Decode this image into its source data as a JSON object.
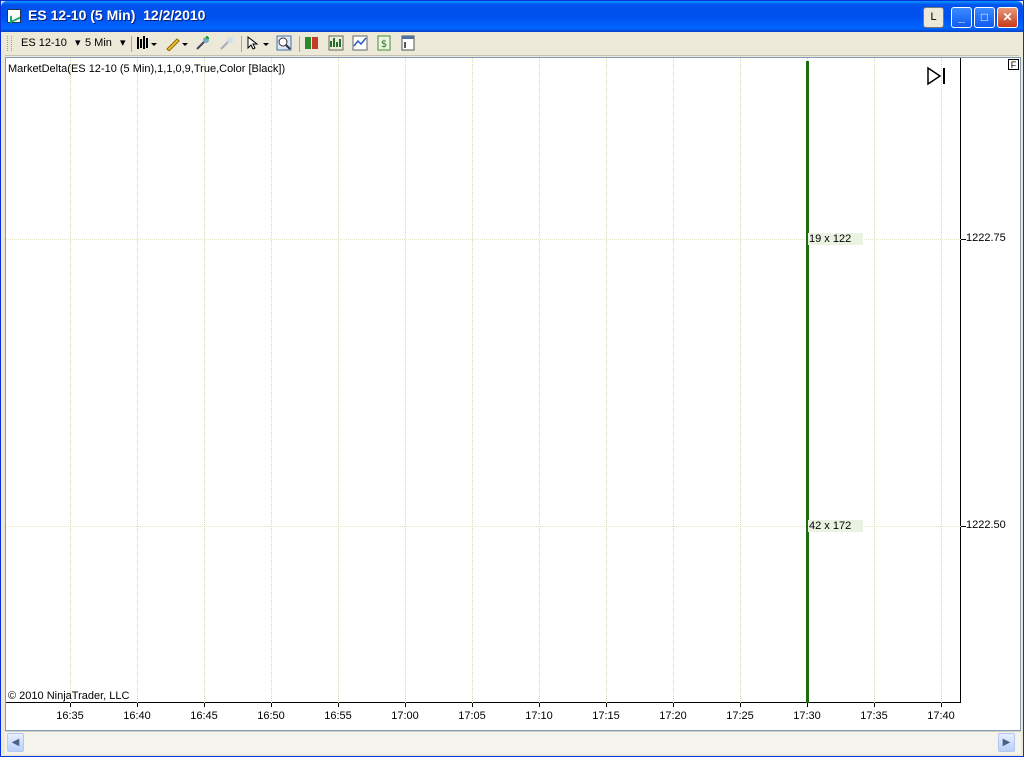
{
  "window": {
    "title": "ES 12-10 (5 Min)  12/2/2010",
    "buttons": {
      "layout": "L",
      "minimize": "_",
      "maximize": "□",
      "close": "✕"
    }
  },
  "toolbar": {
    "instrument": "ES 12-10",
    "interval": "5 Min",
    "dropdown_glyph": "▾"
  },
  "chart": {
    "indicator_label": "MarketDelta(ES 12-10 (5 Min),1,1,0,9,True,Color [Black])",
    "copyright": "© 2010 NinjaTrader, LLC",
    "f_marker": "F",
    "colors": {
      "bar": "#1f6b10",
      "cell_bg": "#eaf2e1",
      "grid": "#d6d6b0"
    }
  },
  "chart_data": {
    "type": "table",
    "x_ticks": [
      "16:35",
      "16:40",
      "16:45",
      "16:50",
      "16:55",
      "17:00",
      "17:05",
      "17:10",
      "17:15",
      "17:20",
      "17:25",
      "17:30",
      "17:35",
      "17:40"
    ],
    "y_ticks": [
      "1222.75",
      "1222.50"
    ],
    "bar_time": "17:30",
    "cells": [
      {
        "price": "1222.75",
        "text": "19 x 122"
      },
      {
        "price": "1222.50",
        "text": "42 x 172"
      }
    ]
  }
}
